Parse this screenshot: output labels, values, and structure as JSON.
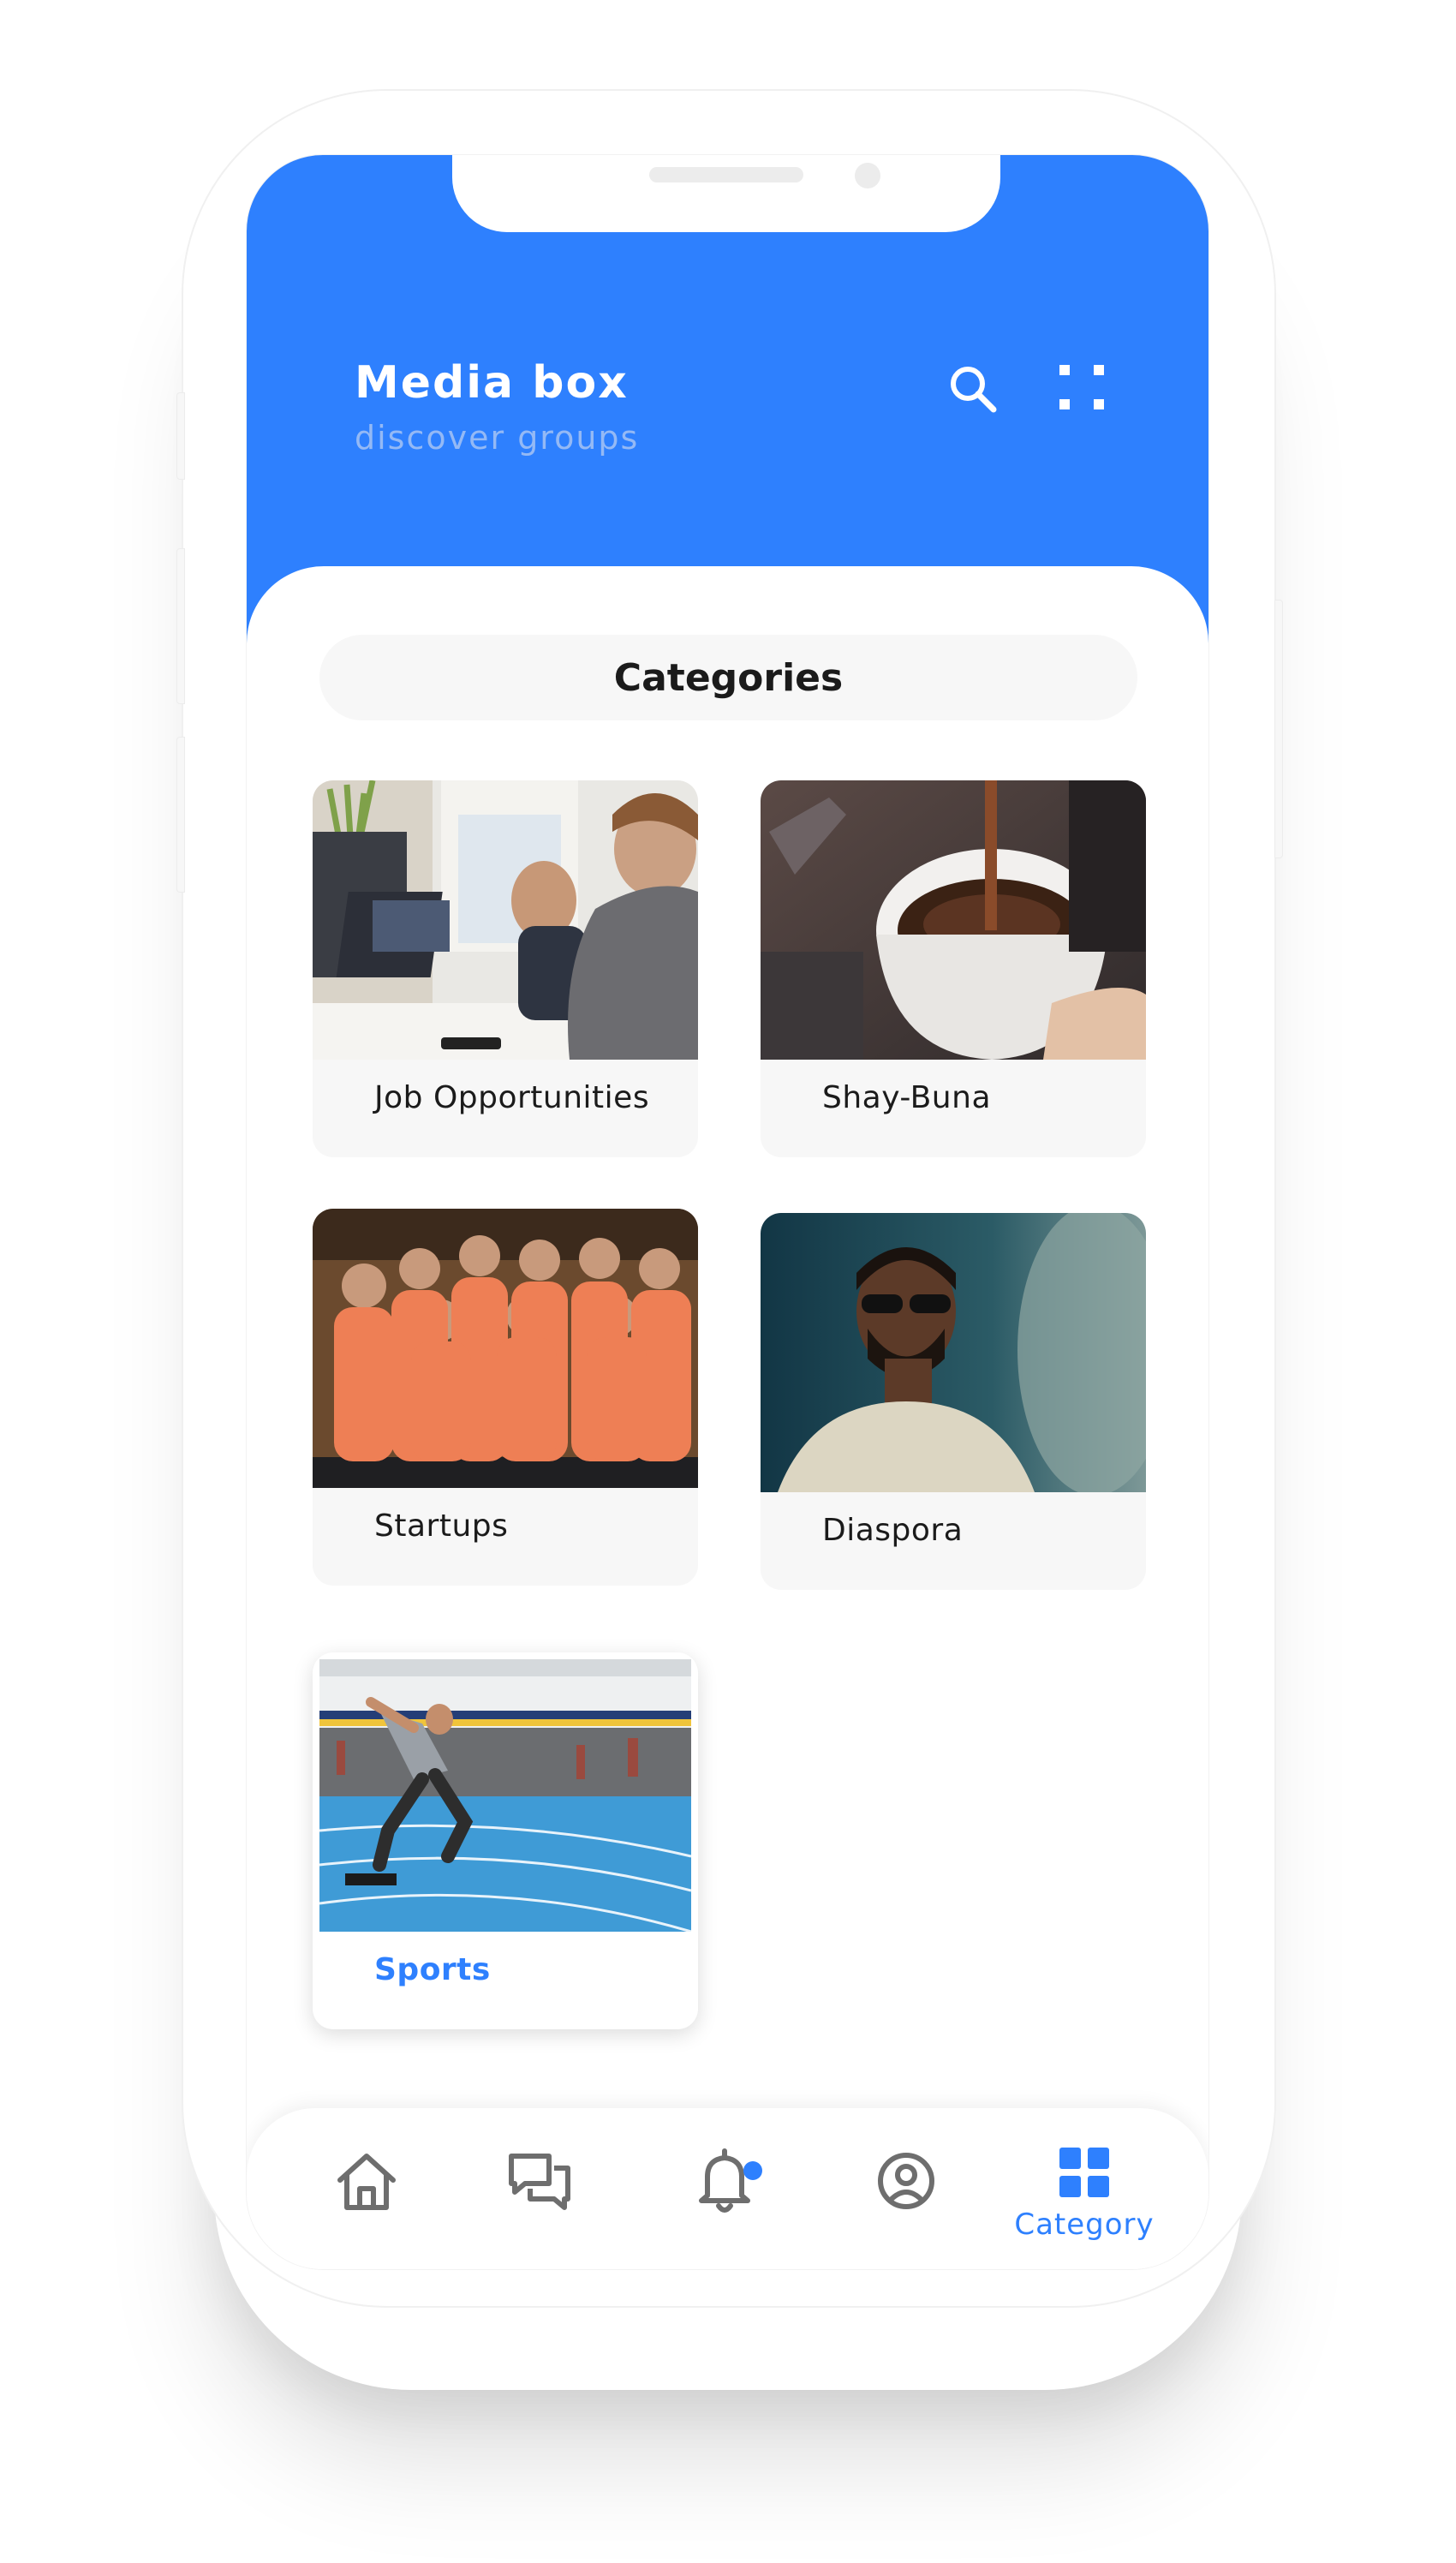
{
  "app": {
    "title": "Media box",
    "subtitle": "discover groups"
  },
  "header_icons": {
    "search": "search-icon",
    "menu": "grid-dots-icon"
  },
  "section": {
    "title": "Categories"
  },
  "categories": [
    {
      "label": "Job Opportunities",
      "photo": "office-workers-at-computers",
      "active": false
    },
    {
      "label": "Shay-Buna",
      "photo": "coffee-cup-pour",
      "active": false
    },
    {
      "label": "Startups",
      "photo": "team-in-orange-shirts",
      "active": false
    },
    {
      "label": "Diaspora",
      "photo": "man-with-sunglasses",
      "active": false
    },
    {
      "label": "Sports",
      "photo": "sprinter-on-track",
      "active": true
    }
  ],
  "bottom_nav": {
    "items": [
      {
        "icon": "home-icon",
        "label": "",
        "active": false
      },
      {
        "icon": "chat-icon",
        "label": "",
        "active": false
      },
      {
        "icon": "bell-icon",
        "label": "",
        "active": false,
        "badge": true
      },
      {
        "icon": "user-circle-icon",
        "label": "",
        "active": false
      },
      {
        "icon": "category-grid-icon",
        "label": "Category",
        "active": true
      }
    ]
  },
  "colors": {
    "primary": "#2e80fe",
    "header_subtitle": "#94b9f5",
    "card_bg": "#f7f7f7",
    "icon_gray": "#6e6e6e"
  }
}
